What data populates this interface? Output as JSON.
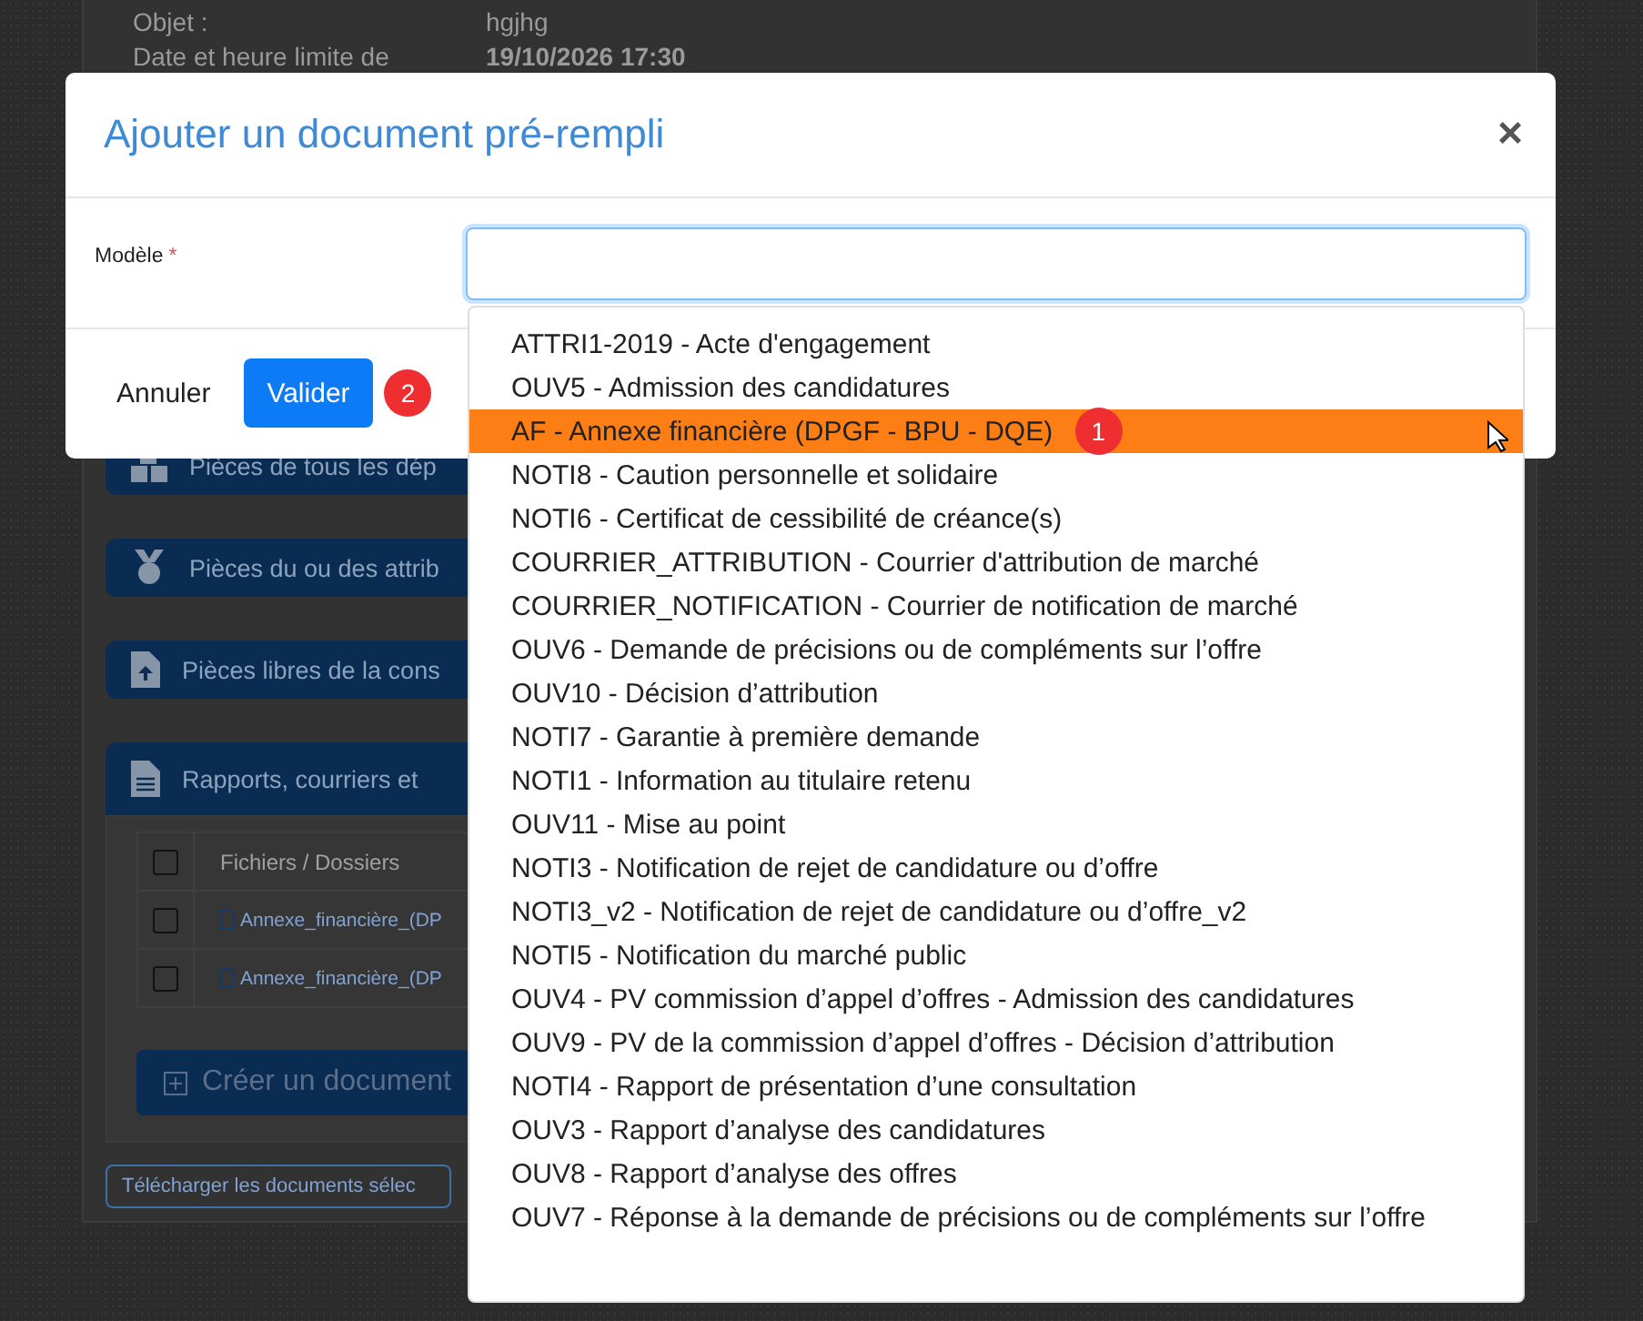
{
  "background_page": {
    "fields": [
      {
        "label": "Objet :",
        "value": "hgjhg"
      },
      {
        "label": "Date et heure limite de",
        "value": "19/10/2026 17:30"
      }
    ],
    "sections": [
      {
        "title": "Pièces de tous les dép"
      },
      {
        "title": "Pièces du ou des attrib"
      },
      {
        "title": "Pièces libres de la cons"
      },
      {
        "title": "Rapports, courriers et"
      }
    ],
    "table": {
      "header_checked": false,
      "column": "Fichiers / Dossiers",
      "rows": [
        {
          "name": "Annexe_financière_(DP",
          "checked": false
        },
        {
          "name": "Annexe_financière_(DP",
          "checked": false
        }
      ]
    },
    "create_button": "Créer un document",
    "download_button": "Télécharger les documents sélec"
  },
  "modal": {
    "title": "Ajouter un document pré-rempli",
    "close": "×",
    "field_label": "Modèle",
    "required_mark": "*",
    "cancel": "Annuler",
    "submit": "Valider",
    "submit_badge": "2"
  },
  "dropdown": {
    "badge": "1",
    "options": [
      {
        "label": "ATTRI1-2019 - Acte d'engagement",
        "selected": false
      },
      {
        "label": "OUV5 - Admission des candidatures",
        "selected": false
      },
      {
        "label": "AF - Annexe financière (DPGF - BPU - DQE)",
        "selected": true
      },
      {
        "label": "NOTI8 - Caution personnelle et solidaire",
        "selected": false
      },
      {
        "label": "NOTI6 - Certificat de cessibilité de créance(s)",
        "selected": false
      },
      {
        "label": "COURRIER_ATTRIBUTION - Courrier d'attribution de marché",
        "selected": false
      },
      {
        "label": "COURRIER_NOTIFICATION - Courrier de notification de marché",
        "selected": false
      },
      {
        "label": "OUV6 - Demande de précisions ou de compléments sur l’offre",
        "selected": false
      },
      {
        "label": "OUV10 - Décision d’attribution",
        "selected": false
      },
      {
        "label": "NOTI7 - Garantie à première demande",
        "selected": false
      },
      {
        "label": "NOTI1 - Information au titulaire retenu",
        "selected": false
      },
      {
        "label": "OUV11 - Mise au point",
        "selected": false
      },
      {
        "label": "NOTI3 - Notification de rejet de candidature ou d’offre",
        "selected": false
      },
      {
        "label": "NOTI3_v2 - Notification de rejet de candidature ou d’offre_v2",
        "selected": false
      },
      {
        "label": "NOTI5 - Notification du marché public",
        "selected": false
      },
      {
        "label": "OUV4 - PV commission d’appel d’offres - Admission des candidatures",
        "selected": false
      },
      {
        "label": "OUV9 - PV de la commission d’appel d’offres - Décision d’attribution",
        "selected": false
      },
      {
        "label": "NOTI4 - Rapport de présentation d’une consultation",
        "selected": false
      },
      {
        "label": "OUV3 - Rapport d’analyse des candidatures",
        "selected": false
      },
      {
        "label": "OUV8 - Rapport d’analyse des offres",
        "selected": false
      },
      {
        "label": "OUV7 - Réponse à la demande de précisions ou de compléments sur l’offre",
        "selected": false
      }
    ]
  }
}
